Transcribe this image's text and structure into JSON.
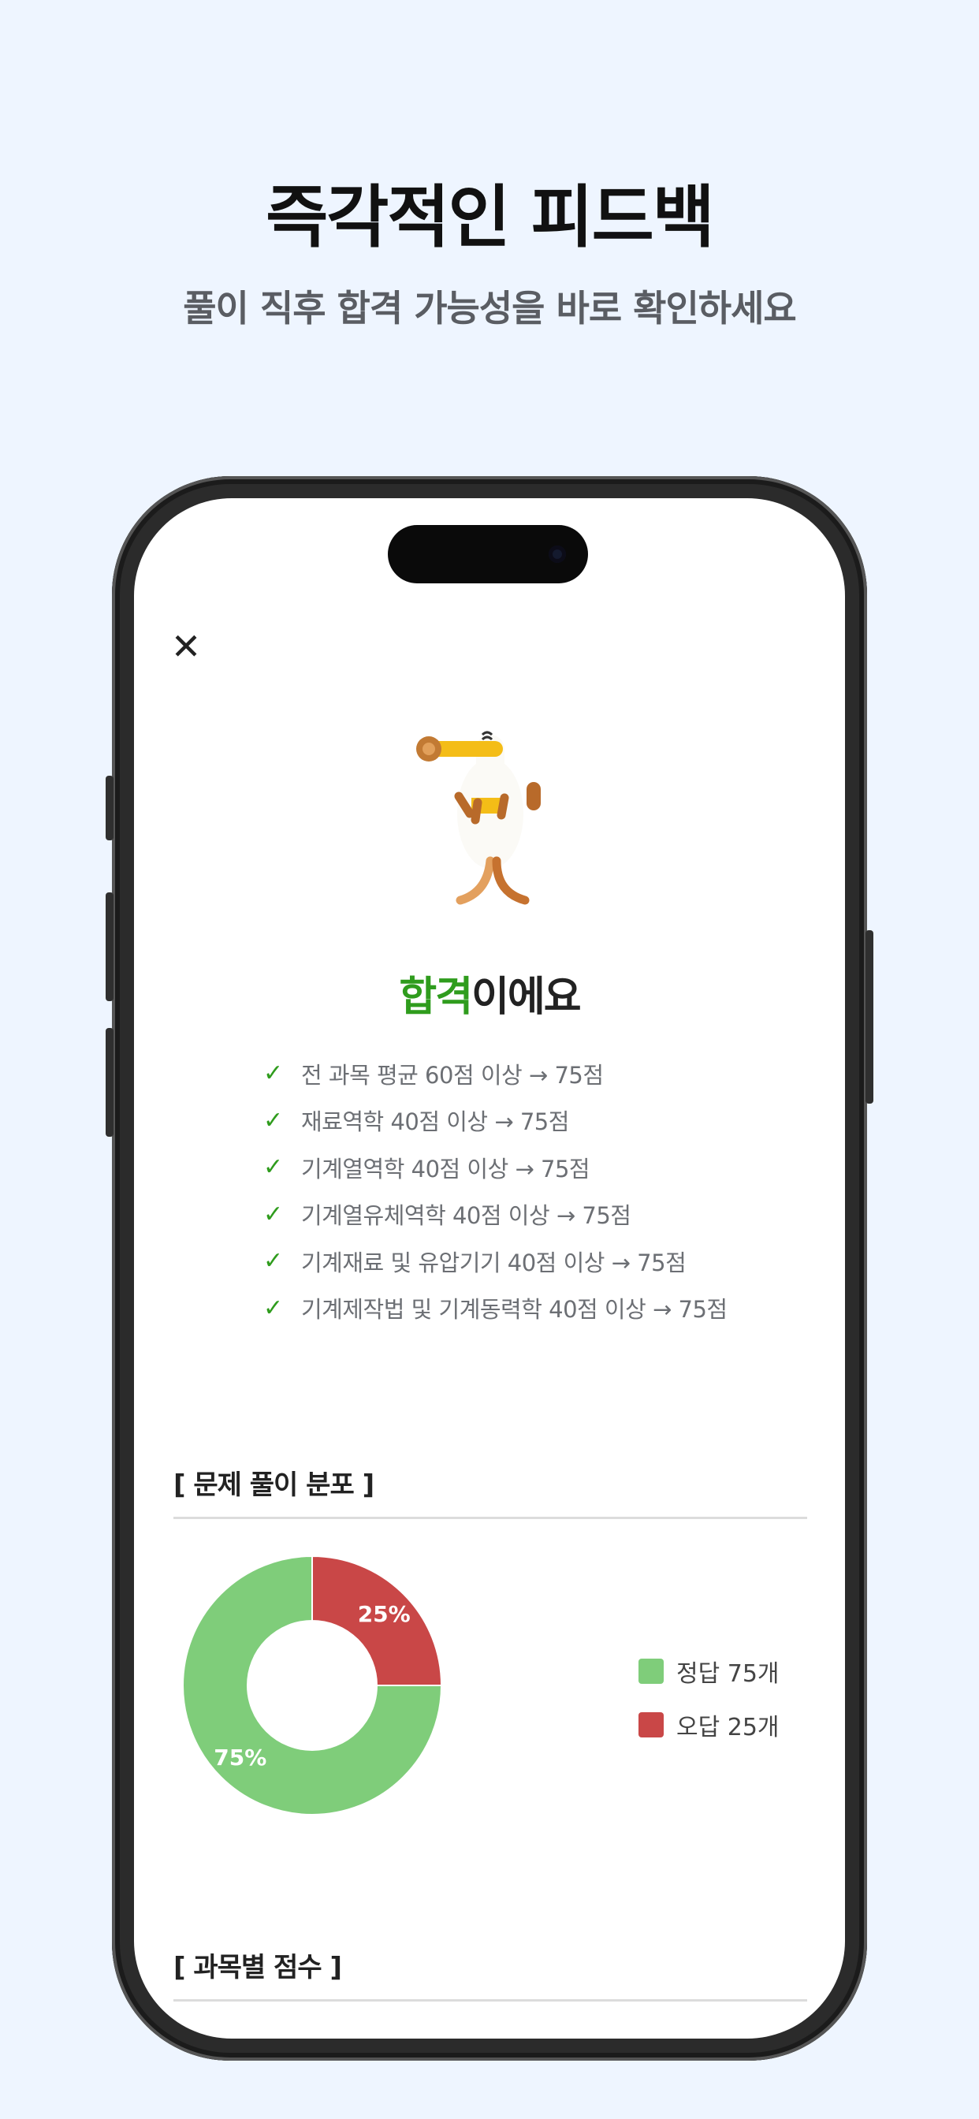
{
  "promo": {
    "headline": "즉각적인 피드백",
    "subline": "풀이 직후 합격 가능성을 바로 확인하세요"
  },
  "screen": {
    "close_icon": "close-icon",
    "result_highlight": "합격",
    "result_rest": "이에요",
    "criteria": [
      "전 과목 평균 60점 이상 → 75점",
      "재료역학 40점 이상 → 75점",
      "기계열역학 40점 이상 → 75점",
      "기계열유체역학 40점 이상 → 75점",
      "기계재료 및 유압기기 40점 이상 → 75점",
      "기계제작법 및 기계동력학 40점 이상 → 75점"
    ],
    "distribution_title": "[ 문제 풀이 분포 ]",
    "subject_title": "[ 과목별 점수 ]"
  },
  "colors": {
    "pass_green": "#2f9c1d",
    "correct": "#7fcd7a",
    "wrong": "#c94747",
    "background": "#eef5ff"
  },
  "chart_data": {
    "type": "pie",
    "donut": true,
    "categories": [
      "정답 75개",
      "오답 25개"
    ],
    "values": [
      75,
      25
    ],
    "value_labels": [
      "75%",
      "25%"
    ],
    "colors": [
      "#7fcd7a",
      "#c94747"
    ],
    "legend_position": "right"
  }
}
